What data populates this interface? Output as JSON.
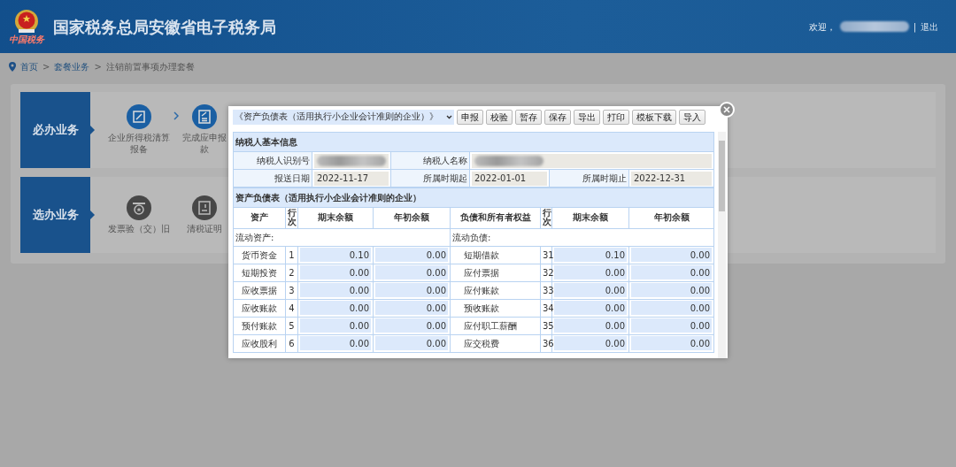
{
  "header": {
    "logo_caption": "中国税务",
    "title": "国家税务总局安徽省电子税务局",
    "welcome": "欢迎，",
    "user_redacted": true,
    "divider": "|",
    "logout": "退出"
  },
  "breadcrumb": [
    {
      "label": "首页",
      "kind": "link"
    },
    {
      "label": ">",
      "kind": "separator"
    },
    {
      "label": "套餐业务",
      "kind": "link"
    },
    {
      "label": ">",
      "kind": "separator"
    },
    {
      "label": "注销前置事项办理套餐",
      "kind": "current"
    }
  ],
  "sections": [
    {
      "title": "必办业务",
      "chevrons": true,
      "steps": [
        {
          "label": "企业所得税清算报备",
          "kind": "edit"
        },
        {
          "label": "完成应申报款",
          "kind": "edit-list"
        }
      ]
    },
    {
      "title": "选办业务",
      "chevrons": false,
      "steps": [
        {
          "label": "发票验（交）旧",
          "kind": "medal"
        },
        {
          "label": "清税证明",
          "kind": "document"
        }
      ]
    }
  ],
  "modal": {
    "report_select": "《资产负债表（适用执行小企业会计准则的企业）》",
    "buttons": [
      "申报",
      "校验",
      "暂存",
      "保存",
      "导出",
      "打印",
      "模板下载",
      "导入"
    ],
    "info_title": "纳税人基本信息",
    "info_rows": [
      [
        {
          "label": "纳税人识别号",
          "redacted": true
        },
        {
          "label": "纳税人名称",
          "redacted": true
        }
      ],
      [
        {
          "label": "报送日期",
          "value": "2022-11-17",
          "redacted": false
        },
        {
          "label": "所属时期起",
          "value": "2022-01-01",
          "redacted": false
        },
        {
          "label": "所属时期止",
          "value": "2022-12-31",
          "redacted": false
        }
      ]
    ],
    "table_title": "资产负债表（适用执行小企业会计准则的企业）",
    "columns": [
      "资产",
      "行次",
      "期末余额",
      "年初余额",
      "负债和所有者权益",
      "行次",
      "期末余额",
      "年初余额"
    ],
    "group_left": "流动资产:",
    "group_right": "流动负债:",
    "rows": [
      {
        "asset": "货币资金",
        "line": "1",
        "end": "0.10",
        "begin": "0.00",
        "liability": "短期借款",
        "line2": "31",
        "end2": "0.10",
        "begin2": "0.00"
      },
      {
        "asset": "短期投资",
        "line": "2",
        "end": "0.00",
        "begin": "0.00",
        "liability": "应付票据",
        "line2": "32",
        "end2": "0.00",
        "begin2": "0.00"
      },
      {
        "asset": "应收票据",
        "line": "3",
        "end": "0.00",
        "begin": "0.00",
        "liability": "应付账款",
        "line2": "33",
        "end2": "0.00",
        "begin2": "0.00"
      },
      {
        "asset": "应收账款",
        "line": "4",
        "end": "0.00",
        "begin": "0.00",
        "liability": "预收账款",
        "line2": "34",
        "end2": "0.00",
        "begin2": "0.00"
      },
      {
        "asset": "预付账款",
        "line": "5",
        "end": "0.00",
        "begin": "0.00",
        "liability": "应付职工薪酬",
        "line2": "35",
        "end2": "0.00",
        "begin2": "0.00"
      },
      {
        "asset": "应收股利",
        "line": "6",
        "end": "0.00",
        "begin": "0.00",
        "liability": "应交税费",
        "line2": "36",
        "end2": "0.00",
        "begin2": "0.00"
      }
    ]
  }
}
